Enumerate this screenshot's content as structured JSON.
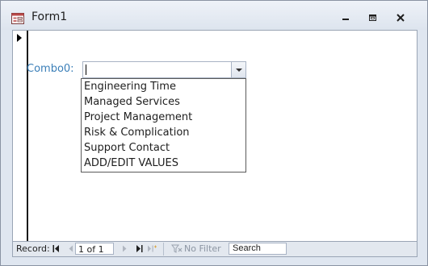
{
  "window": {
    "title": "Form1",
    "controls": [
      "minimize-icon",
      "restore-icon",
      "close-icon"
    ]
  },
  "form": {
    "combo_label": "Combo0:",
    "combo_value": "",
    "dropdown_items": [
      "Engineering Time",
      "Managed Services",
      "Project Management",
      "Risk & Complication",
      "Support Contact",
      "ADD/EDIT VALUES"
    ]
  },
  "navigation": {
    "record_label": "Record:",
    "current_record": "1 of 1",
    "filter_label": "No Filter",
    "search_placeholder": "Search"
  },
  "colors": {
    "label_blue": "#3b7fb8",
    "window_frame": "#dfe6f0",
    "disabled_text": "#8d96a3"
  }
}
